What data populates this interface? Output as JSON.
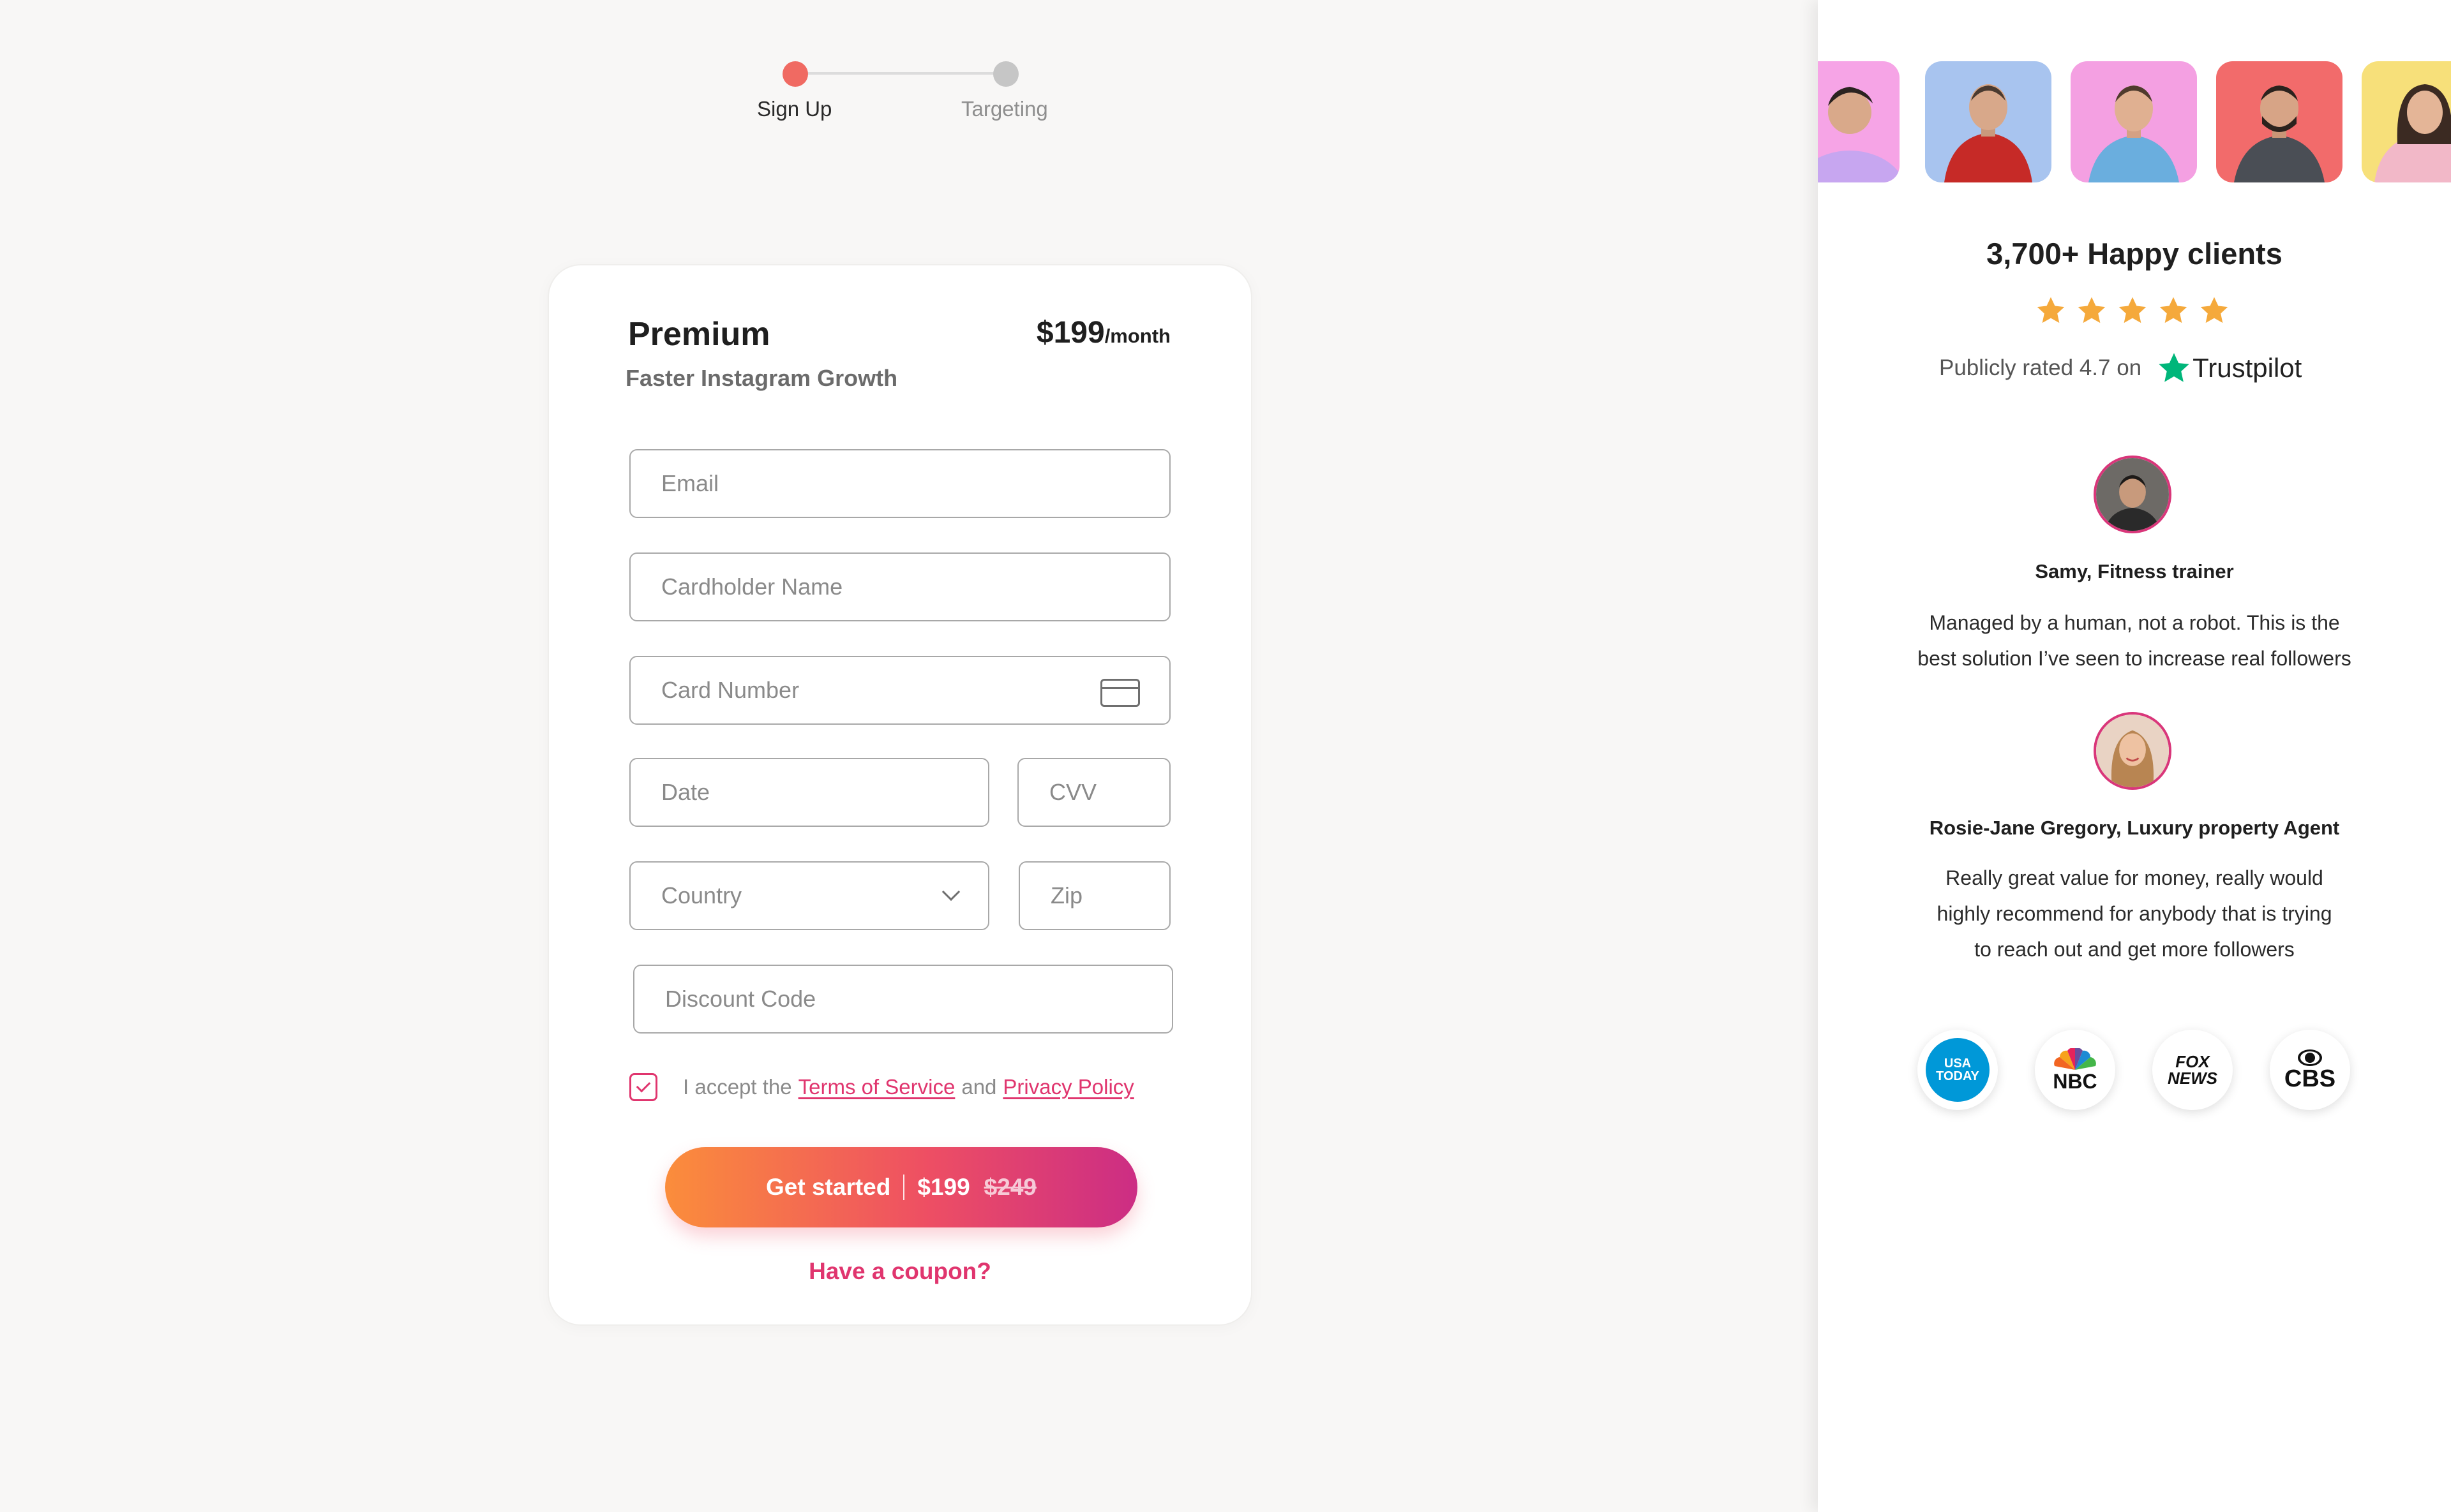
{
  "stepper": {
    "steps": [
      {
        "label": "Sign Up"
      },
      {
        "label": "Targeting"
      }
    ]
  },
  "plan": {
    "name": "Premium",
    "subtitle": "Faster Instagram Growth",
    "price": "$199",
    "period": "/month"
  },
  "form": {
    "email_placeholder": "Email",
    "cardholder_placeholder": "Cardholder Name",
    "card_number_placeholder": "Card Number",
    "date_placeholder": "Date",
    "cvv_placeholder": "CVV",
    "country_placeholder": "Country",
    "zip_placeholder": "Zip",
    "discount_placeholder": "Discount Code",
    "terms_checked": true,
    "terms_prefix": "I accept the",
    "terms_link": "Terms of Service",
    "terms_and": "and",
    "privacy_link": "Privacy Policy"
  },
  "cta": {
    "label": "Get started",
    "price": "$199",
    "old_price": "$249"
  },
  "coupon_link": "Have a coupon?",
  "social": {
    "clients_title": "3,700+ Happy clients",
    "stars": 5,
    "rating_text": "Publicly rated 4.7 on",
    "trustpilot": "Trustpilot"
  },
  "reviews": [
    {
      "author": "Samy, Fitness trainer",
      "lines": [
        "Managed by a human, not a robot. This is the",
        "best solution I’ve seen to increase real followers"
      ]
    },
    {
      "author": "Rosie-Jane Gregory, Luxury property Agent",
      "lines": [
        "Really great value for money, really would",
        "highly recommend for anybody that is trying",
        "to reach out and get more followers"
      ]
    }
  ],
  "press": [
    {
      "icon": "usa-today-logo",
      "line1": "USA",
      "line2": "TODAY"
    },
    {
      "icon": "nbc-logo",
      "text": "NBC"
    },
    {
      "icon": "fox-news-logo",
      "line1": "FOX",
      "line2": "NEWS"
    },
    {
      "icon": "cbs-logo",
      "text": "CBS"
    }
  ],
  "colors": {
    "accent": "#e0356e",
    "step_active": "#f06a62",
    "step_inactive": "#c6c6c6",
    "star": "#f5a93b",
    "trustpilot_green": "#00b67a",
    "cta_gradient_start": "#fb8d3b",
    "cta_gradient_end": "#cc2d84"
  }
}
